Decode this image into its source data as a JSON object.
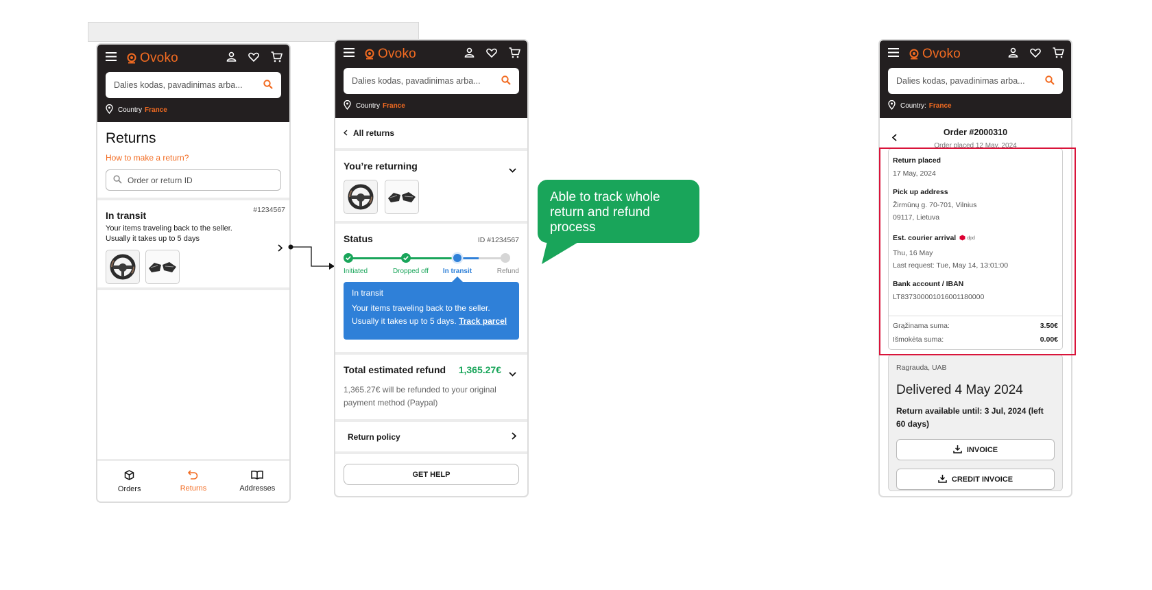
{
  "brand": {
    "name": "Ovoko",
    "accent": "#f26b21",
    "header_bg": "#231f20",
    "green": "#19a55a",
    "blue": "#2f80d8"
  },
  "search": {
    "placeholder": "Dalies kodas, pavadinimas arba..."
  },
  "country": {
    "label_plain": "Country",
    "label_colon": "Country:",
    "value": "France"
  },
  "screen1": {
    "title": "Returns",
    "how_link": "How to make a return?",
    "search_placeholder": "Order or return ID",
    "card": {
      "status": "In transit",
      "id": "#1234567",
      "desc": "Your items traveling back to the seller. Usually it takes up to 5 days"
    },
    "nav": [
      {
        "label": "Orders",
        "icon": "box-icon",
        "active": false
      },
      {
        "label": "Returns",
        "icon": "return-arrow-icon",
        "active": true
      },
      {
        "label": "Addresses",
        "icon": "book-icon",
        "active": false
      }
    ]
  },
  "screen2": {
    "back": "All returns",
    "returning_title": "You’re returning",
    "status_title": "Status",
    "status_id": "ID #1234567",
    "steps": [
      {
        "label": "Initiated",
        "state": "done"
      },
      {
        "label": "Dropped off",
        "state": "done"
      },
      {
        "label": "In transit",
        "state": "current"
      },
      {
        "label": "Refund",
        "state": "pending"
      }
    ],
    "info": {
      "title": "In transit",
      "text": "Your items traveling back to the seller. Usually it takes up to 5 days.",
      "link": "Track parcel"
    },
    "refund_title": "Total estimated refund",
    "refund_amount": "1,365.27€",
    "refund_note": "1,365.27€ will be refunded to your original payment method (Paypal)",
    "policy": "Return policy",
    "help_button": "GET HELP"
  },
  "callout": {
    "text": "Able to track whole return and refund process"
  },
  "screen3": {
    "order_title": "Order #2000310",
    "order_sub": "Order placed 12 May, 2024",
    "return_placed_label": "Return placed",
    "return_placed_value": "17 May, 2024",
    "pickup_label": "Pick up address",
    "pickup_line1": "Žirmūnų g. 70-701, Vilnius",
    "pickup_line2": "09117, Lietuva",
    "courier_label": "Est. courier arrival",
    "courier_brand": "dpd",
    "courier_value": "Thu, 16 May",
    "courier_last": "Last request: Tue, May 14, 13:01:00",
    "bank_label": "Bank account / IBAN",
    "bank_value": "LT837300001016001180000",
    "sum1_label": "Grąžinama suma:",
    "sum1_value": "3.50€",
    "sum2_label": "Išmokėta suma:",
    "sum2_value": "0.00€",
    "seller": "Ragrauda, UAB",
    "delivered": "Delivered 4 May 2024",
    "available": "Return available until: 3 Jul, 2024 (left 60 days)",
    "invoice_btn": "INVOICE",
    "credit_btn": "CREDIT INVOICE"
  }
}
